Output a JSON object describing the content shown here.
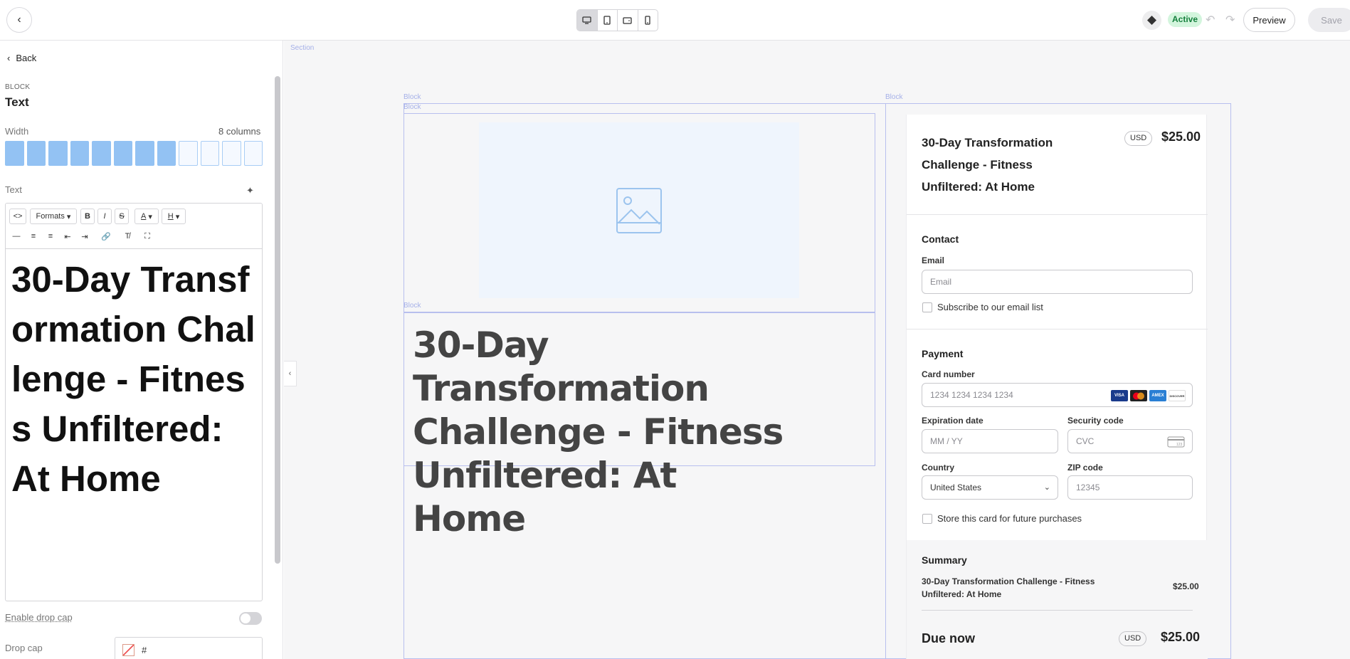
{
  "topbar": {
    "back_icon": "chevron-left-icon",
    "devices": [
      "desktop-icon",
      "tablet-icon",
      "tablet-landscape-icon",
      "mobile-icon"
    ],
    "status": "Active",
    "preview_label": "Preview",
    "save_label": "Save"
  },
  "sidebar": {
    "back_label": "Back",
    "block_caption": "BLOCK",
    "block_title": "Text",
    "width_label": "Width",
    "columns_label": "8 columns",
    "columns_selected": 8,
    "columns_total": 12,
    "text_label": "Text",
    "formats_label": "Formats",
    "editor_content": "30-Day Transformation Challenge - Fitness Unfiltered: At Home",
    "drop_cap_toggle_label": "Enable drop cap",
    "drop_cap_label": "Drop cap",
    "drop_cap_value": "#"
  },
  "canvas": {
    "section_tag": "Section",
    "block_tag": "Block",
    "heading": "30-Day Transformation Challenge - Fitness Unfiltered: At Home"
  },
  "checkout": {
    "title": "30-Day Transformation Challenge - Fitness Unfiltered: At Home",
    "currency": "USD",
    "price": "$25.00",
    "contact_heading": "Contact",
    "email_label": "Email",
    "email_placeholder": "Email",
    "subscribe_label": "Subscribe to our email list",
    "payment_heading": "Payment",
    "card_number_label": "Card number",
    "card_number_placeholder": "1234 1234 1234 1234",
    "expiration_label": "Expiration date",
    "expiration_placeholder": "MM / YY",
    "security_label": "Security code",
    "security_placeholder": "CVC",
    "country_label": "Country",
    "country_value": "United States",
    "zip_label": "ZIP code",
    "zip_placeholder": "12345",
    "store_card_label": "Store this card for future purchases",
    "summary_heading": "Summary",
    "summary_item": "30-Day Transformation Challenge - Fitness Unfiltered: At Home",
    "summary_item_price": "$25.00",
    "due_label": "Due now",
    "due_currency": "USD",
    "due_price": "$25.00",
    "card_brands": [
      "VISA",
      "MC",
      "AMEX",
      "DISCOVER"
    ]
  }
}
